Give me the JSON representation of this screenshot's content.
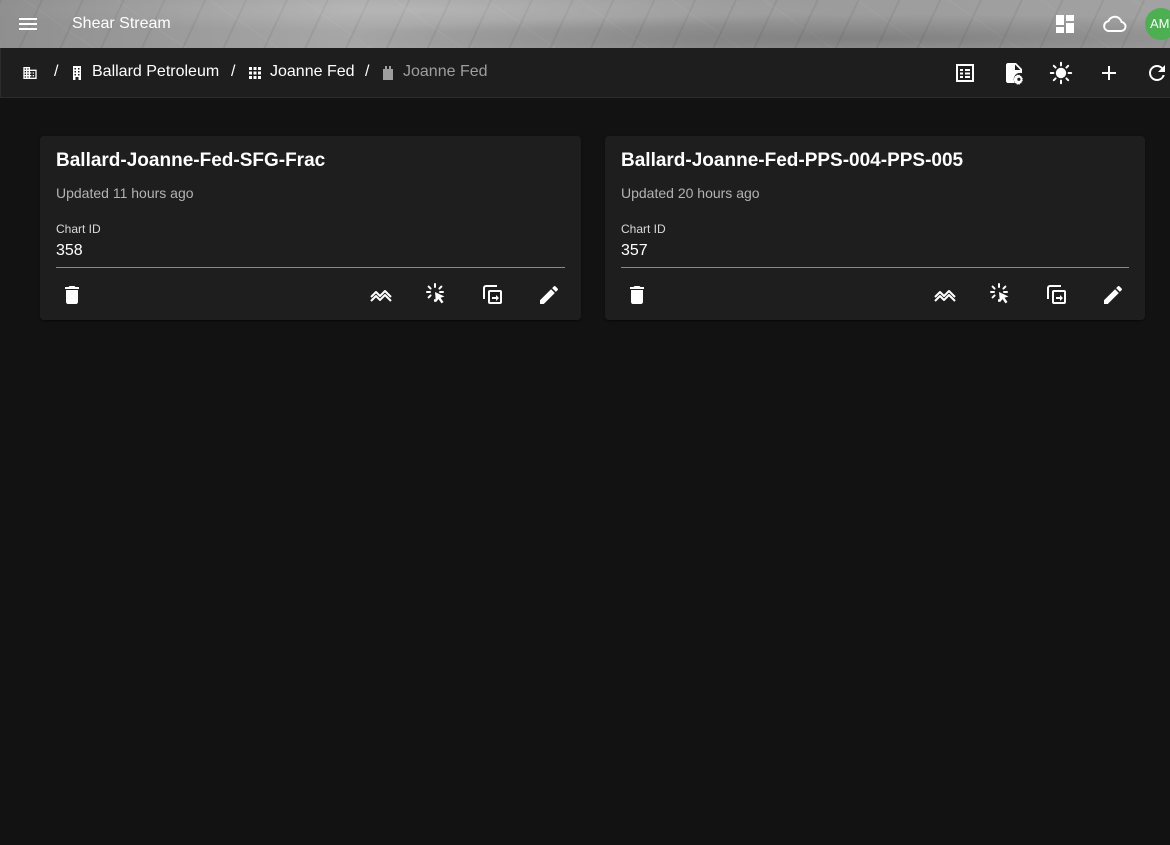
{
  "app": {
    "title": "Shear Stream",
    "user_initials": "AM"
  },
  "breadcrumb": {
    "items": [
      {
        "label": "Ballard Petroleum",
        "icon": "building-icon"
      },
      {
        "label": "Joanne Fed",
        "icon": "grid-dots-icon"
      },
      {
        "label": "Joanne Fed",
        "icon": "well-icon"
      }
    ],
    "separator": "/",
    "root_icon": "company-icon"
  },
  "toolbar": {
    "icons": [
      "table-icon",
      "file-settings-icon",
      "brightness-icon",
      "add-icon",
      "refresh-icon"
    ]
  },
  "cards": [
    {
      "title": "Ballard-Joanne-Fed-SFG-Frac",
      "updated": "Updated 11 hours ago",
      "field_label": "Chart ID",
      "field_value": "358"
    },
    {
      "title": "Ballard-Joanne-Fed-PPS-004-PPS-005",
      "updated": "Updated 20 hours ago",
      "field_label": "Chart ID",
      "field_value": "357"
    }
  ],
  "card_actions": [
    "delete-icon",
    "chart-line-icon",
    "select-click-icon",
    "copy-icon",
    "edit-icon"
  ],
  "colors": {
    "background": "#121212",
    "surface": "#1e1e1e",
    "avatar": "#4caf50",
    "muted_text": "#9e9e9e"
  }
}
